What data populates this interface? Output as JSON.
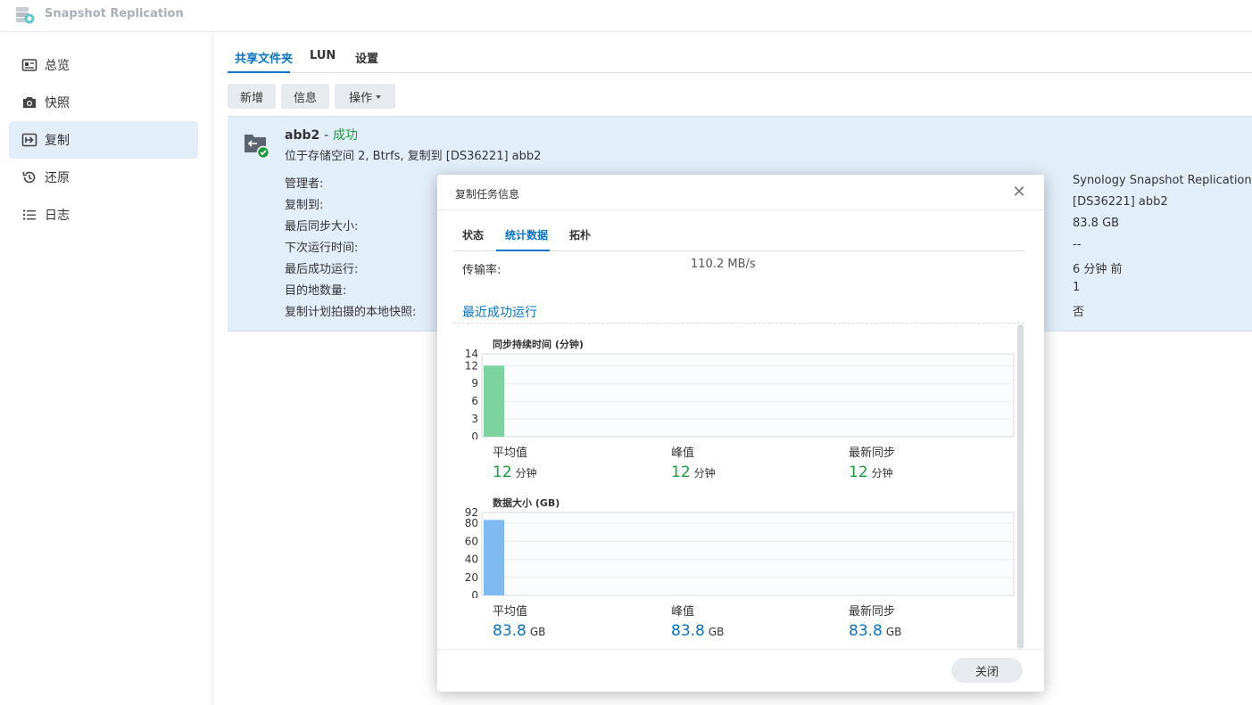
{
  "app": {
    "title": "Snapshot Replication"
  },
  "sidebar": {
    "items": [
      {
        "label": "总览",
        "icon": "overview-icon"
      },
      {
        "label": "快照",
        "icon": "camera-icon"
      },
      {
        "label": "复制",
        "icon": "replication-icon",
        "active": true
      },
      {
        "label": "还原",
        "icon": "restore-icon"
      },
      {
        "label": "日志",
        "icon": "log-icon"
      }
    ]
  },
  "main": {
    "tabs": [
      "共享文件夹",
      "LUN",
      "设置"
    ],
    "toolbar": {
      "add": "新增",
      "info": "信息",
      "actions": "操作"
    },
    "task": {
      "name": "abb2",
      "separator": "-",
      "status": "成功",
      "description": "位于存储空间 2, Btrfs, 复制到 [DS36221] abb2",
      "fields": [
        {
          "label": "管理者:",
          "value": "Synology Snapshot Replication"
        },
        {
          "label": "复制到:",
          "value": "[DS36221] abb2"
        },
        {
          "label": "最后同步大小:",
          "value": "83.8 GB"
        },
        {
          "label": "下次运行时间:",
          "value": "--"
        },
        {
          "label": "最后成功运行:",
          "value": "6 分钟 前"
        },
        {
          "label": "目的地数量:",
          "value": "1"
        },
        {
          "label": "复制计划拍摄的本地快照:",
          "value": "否"
        }
      ]
    }
  },
  "dialog": {
    "title": "复制任务信息",
    "tabs": [
      "状态",
      "统计数据",
      "拓朴"
    ],
    "transfer_rate_label": "传输率:",
    "transfer_rate_value": "110.2 MB/s",
    "section_title": "最近成功运行",
    "close_button": "关闭",
    "colors": {
      "duration_bar": "#7dd3a0",
      "size_bar": "#7fbaf0",
      "accent": "#0a73c6",
      "success": "#1a9c3c"
    },
    "duration": {
      "stats": [
        {
          "label": "平均值",
          "value": "12",
          "unit": "分钟"
        },
        {
          "label": "峰值",
          "value": "12",
          "unit": "分钟"
        },
        {
          "label": "最新同步",
          "value": "12",
          "unit": "分钟"
        }
      ]
    },
    "size": {
      "stats": [
        {
          "label": "平均值",
          "value": "83.8",
          "unit": "GB"
        },
        {
          "label": "峰值",
          "value": "83.8",
          "unit": "GB"
        },
        {
          "label": "最新同步",
          "value": "83.8",
          "unit": "GB"
        }
      ]
    }
  },
  "chart_data": [
    {
      "type": "bar",
      "title": "同步持续时间 (分钟)",
      "yticks": [
        0,
        3,
        6,
        9,
        12,
        14
      ],
      "ylim": [
        0,
        14
      ],
      "values": [
        12
      ],
      "color": "#7dd3a0",
      "grid": true
    },
    {
      "type": "bar",
      "title": "数据大小 (GB)",
      "yticks": [
        0,
        20,
        40,
        60,
        80,
        92
      ],
      "ylim": [
        0,
        92
      ],
      "values": [
        83.8
      ],
      "color": "#7fbaf0",
      "grid": true
    }
  ]
}
